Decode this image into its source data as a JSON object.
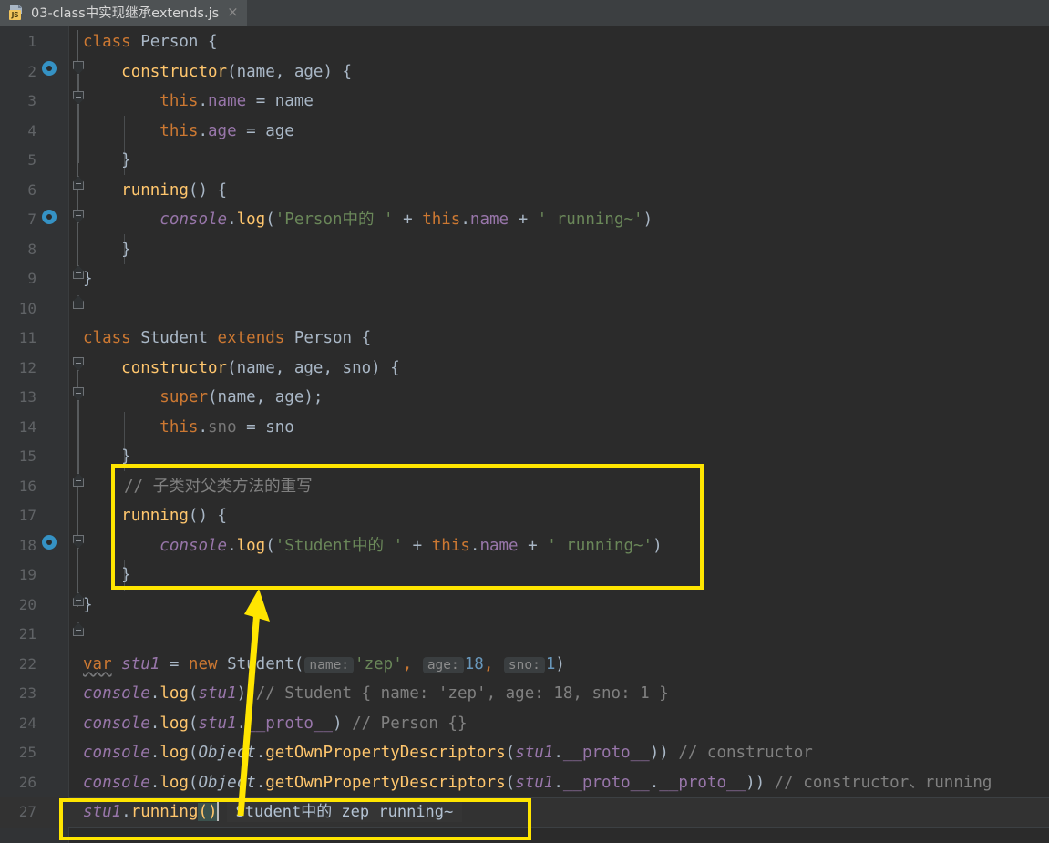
{
  "window": {
    "tab": {
      "title": "03-class中实现继承extends.js",
      "icon": "js-file-icon",
      "badge": "JS",
      "close": "×"
    }
  },
  "editor": {
    "background": "#2B2B2B",
    "gutter_background": "#313335",
    "current_line": 27,
    "colors": {
      "keyword": "#CC7832",
      "function": "#FFC66D",
      "string": "#6A8759",
      "number": "#6897BB",
      "comment": "#808080",
      "field": "#9876AA",
      "default": "#A9B7C6",
      "line_number": "#606366",
      "annotation": "#FFE500"
    },
    "lines": [
      {
        "n": "1",
        "text": "class Person {"
      },
      {
        "n": "2",
        "text": "    constructor(name, age) {"
      },
      {
        "n": "3",
        "text": "        this.name = name"
      },
      {
        "n": "4",
        "text": "        this.age = age"
      },
      {
        "n": "5",
        "text": "    }"
      },
      {
        "n": "6",
        "text": "    running() {"
      },
      {
        "n": "7",
        "text": "        console.log('Person中的 ' + this.name + ' running~')"
      },
      {
        "n": "8",
        "text": "    }"
      },
      {
        "n": "9",
        "text": "}"
      },
      {
        "n": "10",
        "text": ""
      },
      {
        "n": "11",
        "text": "class Student extends Person {"
      },
      {
        "n": "12",
        "text": "    constructor(name, age, sno) {"
      },
      {
        "n": "13",
        "text": "        super(name, age);"
      },
      {
        "n": "14",
        "text": "        this.sno = sno"
      },
      {
        "n": "15",
        "text": "    }"
      },
      {
        "n": "16",
        "text": "    // 子类对父类方法的重写"
      },
      {
        "n": "17",
        "text": "    running() {"
      },
      {
        "n": "18",
        "text": "        console.log('Student中的 ' + this.name + ' running~')"
      },
      {
        "n": "19",
        "text": "    }"
      },
      {
        "n": "20",
        "text": "}"
      },
      {
        "n": "21",
        "text": ""
      },
      {
        "n": "22",
        "text": "var stu1 = new Student( name: 'zep', age: 18, sno: 1)"
      },
      {
        "n": "23",
        "text": "console.log(stu1) // Student { name: 'zep', age: 18, sno: 1 }"
      },
      {
        "n": "24",
        "text": "console.log(stu1.__proto__) // Person {}"
      },
      {
        "n": "25",
        "text": "console.log(Object.getOwnPropertyDescriptors(stu1.__proto__)) // constructor"
      },
      {
        "n": "26",
        "text": "console.log(Object.getOwnPropertyDescriptors(stu1.__proto__.__proto__)) // constructor、running"
      },
      {
        "n": "27",
        "text": "stu1.running()"
      }
    ],
    "inline_hints_line22": [
      "name:",
      "age:",
      "sno:"
    ],
    "inline_result_line27": "Student中的 zep running~",
    "comment_line16": "// 子类对父类方法的重写",
    "gutter_markers": [
      {
        "line": "1",
        "type": "implemented-method-marker",
        "arrow": "down"
      },
      {
        "line": "6",
        "type": "implemented-method-marker",
        "arrow": "down"
      },
      {
        "line": "17",
        "type": "overriding-method-marker",
        "arrow": "up"
      }
    ]
  },
  "annotations": {
    "box_override_label": "override-method-highlight",
    "box_call_label": "method-call-highlight",
    "arrow_label": "call-to-definition-arrow",
    "color": "#FFE500"
  }
}
